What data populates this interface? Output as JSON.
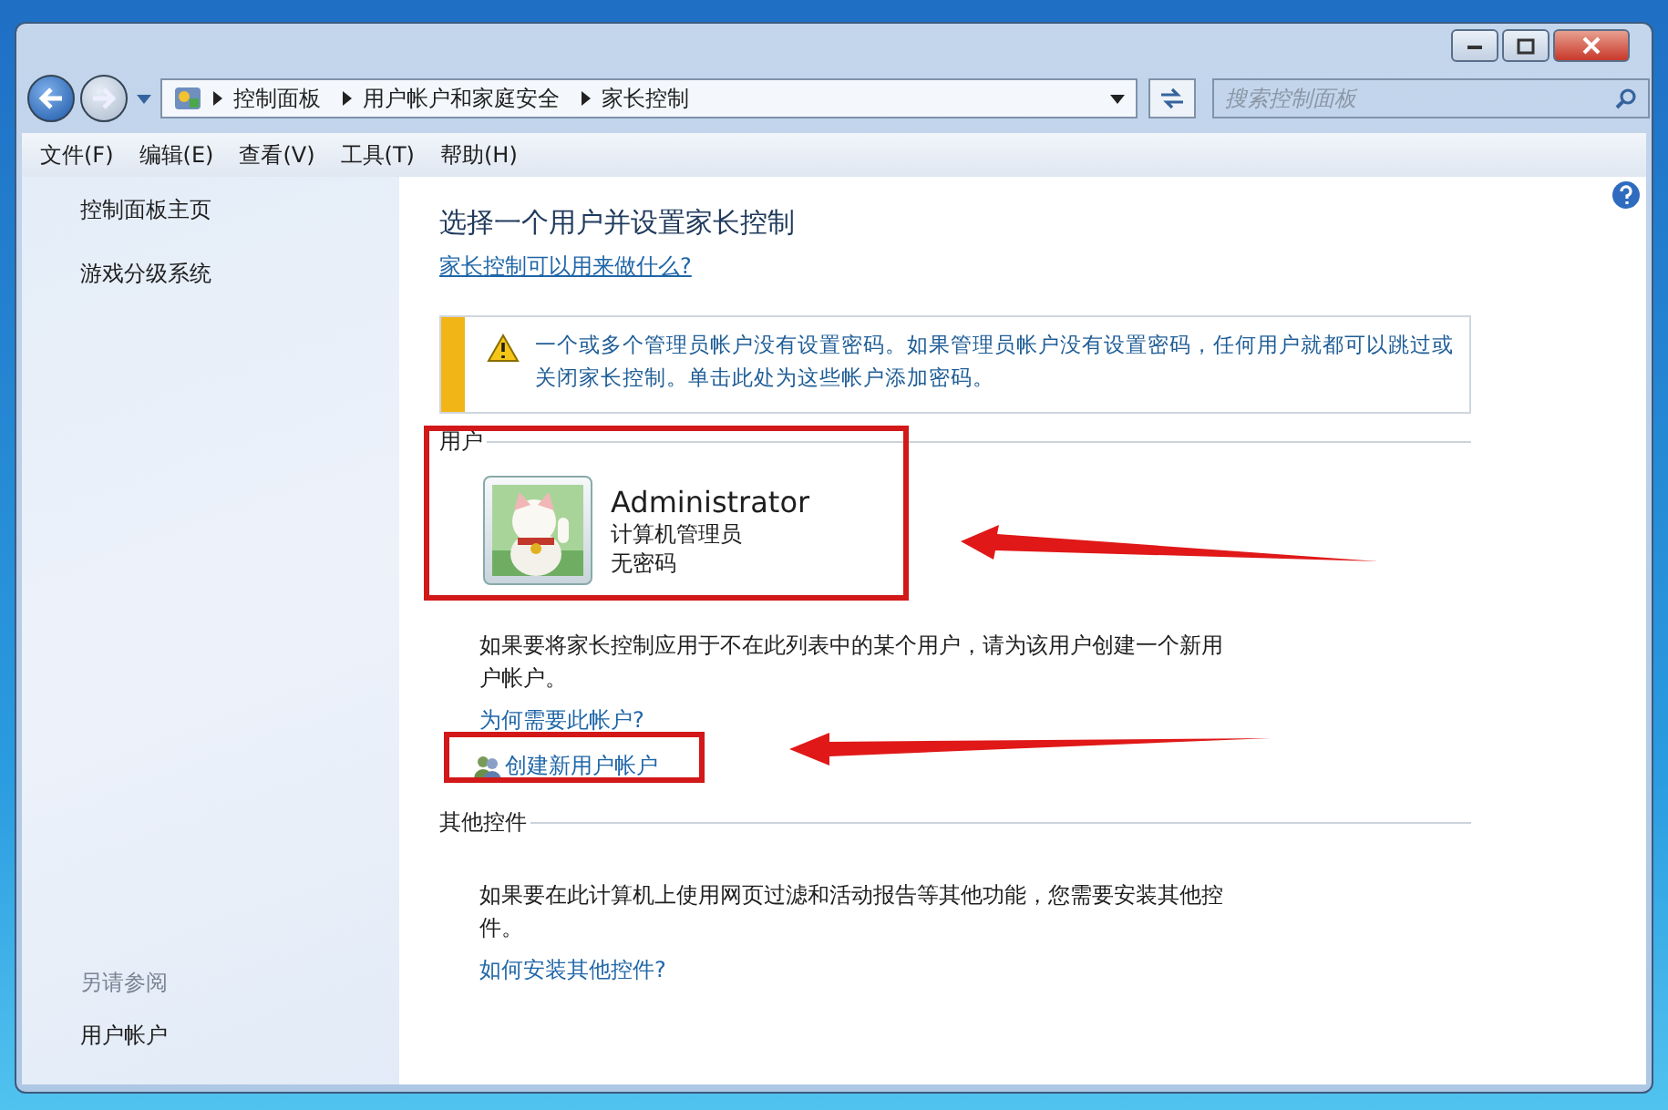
{
  "address_bar": {
    "crumbs": [
      "控制面板",
      "用户帐户和家庭安全",
      "家长控制"
    ]
  },
  "search": {
    "placeholder": "搜索控制面板"
  },
  "menu": [
    "文件(F)",
    "编辑(E)",
    "查看(V)",
    "工具(T)",
    "帮助(H)"
  ],
  "sidebar": {
    "items": [
      "控制面板主页",
      "游戏分级系统"
    ],
    "see_also": {
      "heading": "另请参阅",
      "links": [
        "用户帐户"
      ]
    }
  },
  "main": {
    "title": "选择一个用户并设置家长控制",
    "help_link": "家长控制可以用来做什么?",
    "warning": "一个或多个管理员帐户没有设置密码。如果管理员帐户没有设置密码，任何用户就都可以跳过或关闭家长控制。单击此处为这些帐户添加密码。",
    "users_section": {
      "heading": "用户",
      "users": [
        {
          "name": "Administrator",
          "role": "计算机管理员",
          "password": "无密码"
        }
      ],
      "note": "如果要将家长控制应用于不在此列表中的某个用户，请为该用户创建一个新用户帐户。",
      "why_link": "为何需要此帐户?",
      "create_link": "创建新用户帐户"
    },
    "controls_section": {
      "heading": "其他控件",
      "note": "如果要在此计算机上使用网页过滤和活动报告等其他功能，您需要安装其他控件。",
      "link": "如何安装其他控件?"
    }
  }
}
